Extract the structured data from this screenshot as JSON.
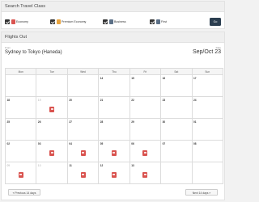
{
  "travel_class": {
    "title": "Search Travel Class",
    "options": [
      {
        "label": "Economy",
        "color": "#d9534f"
      },
      {
        "label": "Premium Economy",
        "color": "#e8a33d"
      },
      {
        "label": "Business",
        "color": "#5b6f86"
      },
      {
        "label": "First",
        "color": "#5b6f86"
      }
    ],
    "go_label": "Go"
  },
  "flights": {
    "title": "Flights Out",
    "from_label": "From",
    "route": "Sydney to Tokyo (Haneda)",
    "date_label": "Date",
    "month": "Sep/Oct 23",
    "weekdays": [
      "Mon",
      "Tue",
      "Wed",
      "Thu",
      "Fri",
      "Sat",
      "Sun"
    ],
    "weeks": [
      [
        {
          "day": "",
          "seat": false
        },
        {
          "day": "",
          "seat": false
        },
        {
          "day": "",
          "seat": false
        },
        {
          "day": "14",
          "seat": false
        },
        {
          "day": "15",
          "seat": false
        },
        {
          "day": "16",
          "seat": false
        },
        {
          "day": "17",
          "seat": false
        }
      ],
      [
        {
          "day": "18",
          "seat": false
        },
        {
          "day": "19",
          "seat": true,
          "muted": true
        },
        {
          "day": "20",
          "seat": false
        },
        {
          "day": "21",
          "seat": false
        },
        {
          "day": "22",
          "seat": false
        },
        {
          "day": "23",
          "seat": false
        },
        {
          "day": "24",
          "seat": false
        }
      ],
      [
        {
          "day": "25",
          "seat": false
        },
        {
          "day": "26",
          "seat": false
        },
        {
          "day": "27",
          "seat": false
        },
        {
          "day": "28",
          "seat": false
        },
        {
          "day": "29",
          "seat": false
        },
        {
          "day": "30",
          "seat": false
        },
        {
          "day": "01",
          "seat": false
        }
      ],
      [
        {
          "day": "02",
          "seat": false
        },
        {
          "day": "03",
          "seat": true
        },
        {
          "day": "04",
          "seat": true
        },
        {
          "day": "05",
          "seat": true
        },
        {
          "day": "06",
          "seat": true
        },
        {
          "day": "07",
          "seat": false
        },
        {
          "day": "08",
          "seat": false
        }
      ],
      [
        {
          "day": "09",
          "seat": true,
          "muted": true
        },
        {
          "day": "10",
          "seat": false,
          "muted": true
        },
        {
          "day": "11",
          "seat": true
        },
        {
          "day": "12",
          "seat": true
        },
        {
          "day": "13",
          "seat": true
        },
        {
          "day": "",
          "seat": false
        },
        {
          "day": "",
          "seat": false
        }
      ]
    ],
    "prev_label": "« Previous 14 days",
    "next_label": "Next 14 days »"
  }
}
